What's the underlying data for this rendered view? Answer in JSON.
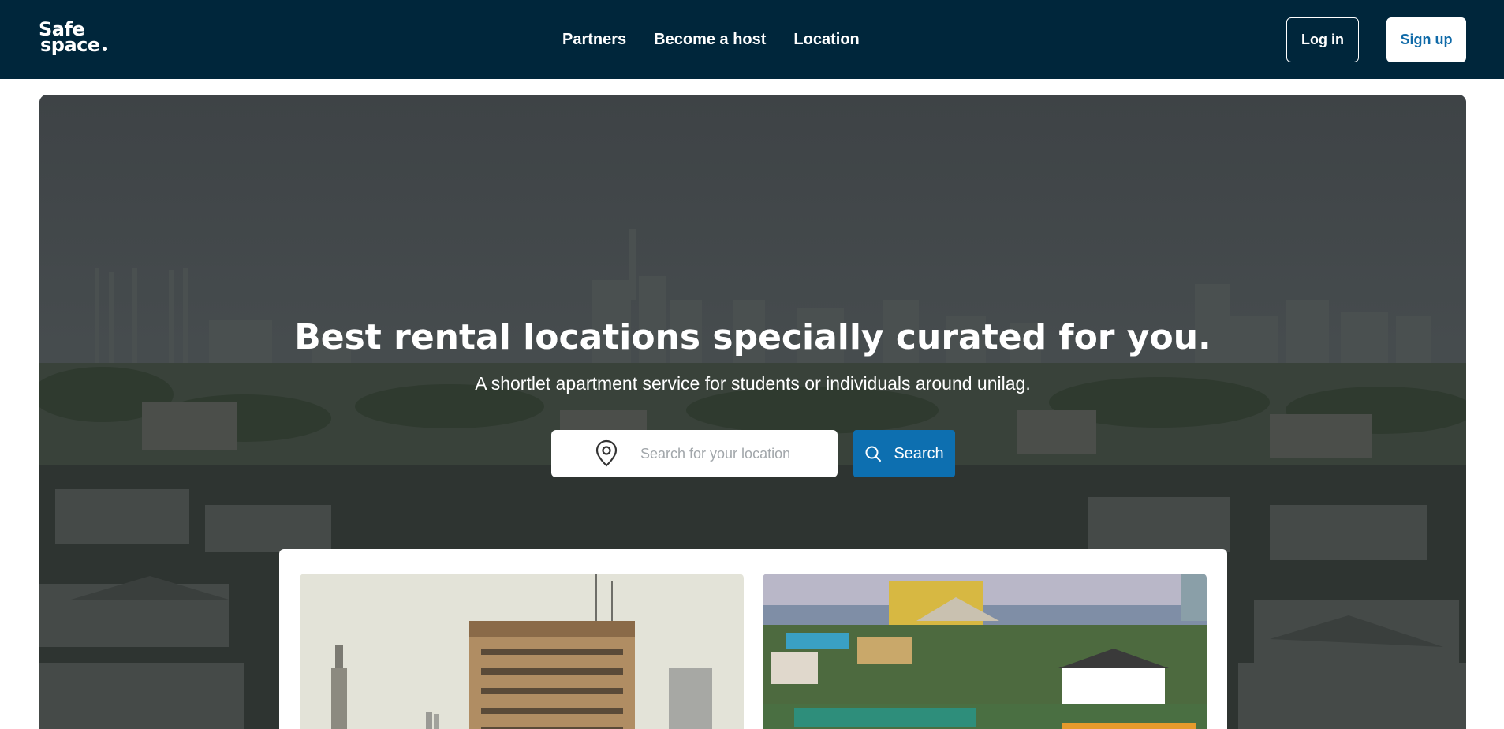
{
  "brand": {
    "logo_line1": "Safe",
    "logo_line2": "space"
  },
  "nav": {
    "items": [
      {
        "label": "Partners"
      },
      {
        "label": "Become a host"
      },
      {
        "label": "Location"
      }
    ]
  },
  "auth": {
    "login_label": "Log in",
    "signup_label": "Sign up"
  },
  "hero": {
    "title": "Best rental locations specially curated for you.",
    "subtitle": "A shortlet apartment service for students or individuals around unilag.",
    "search_placeholder": "Search for your location",
    "search_button": "Search"
  },
  "colors": {
    "header_bg": "#00263b",
    "accent": "#0d6fb0"
  },
  "icons": {
    "location": "location-pin-icon",
    "search": "search-icon"
  }
}
